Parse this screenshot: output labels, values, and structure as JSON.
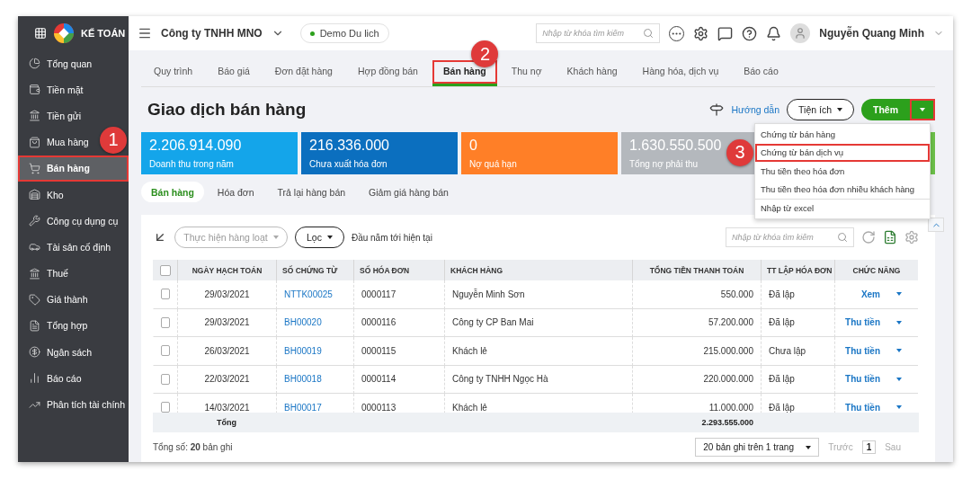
{
  "logo": {
    "text": "KẾ TOÁN"
  },
  "topbar": {
    "company": "Công ty TNHH MNO",
    "db_badge": "Demo Du lich",
    "search_placeholder": "Nhập từ khóa tìm kiếm",
    "user": "Nguyễn Quang Minh"
  },
  "sidebar": {
    "items": [
      {
        "label": "Tổng quan",
        "selected": false,
        "highlighted": false
      },
      {
        "label": "Tiền mặt",
        "selected": false,
        "highlighted": false
      },
      {
        "label": "Tiền gửi",
        "selected": false,
        "highlighted": false
      },
      {
        "label": "Mua hàng",
        "selected": false,
        "highlighted": false
      },
      {
        "label": "Bán hàng",
        "selected": true,
        "highlighted": true,
        "callout": "1"
      },
      {
        "label": "Kho",
        "selected": false,
        "highlighted": false
      },
      {
        "label": "Công cụ dụng cụ",
        "selected": false,
        "highlighted": false
      },
      {
        "label": "Tài sản cố định",
        "selected": false,
        "highlighted": false
      },
      {
        "label": "Thuế",
        "selected": false,
        "highlighted": false
      },
      {
        "label": "Giá thành",
        "selected": false,
        "highlighted": false
      },
      {
        "label": "Tổng hợp",
        "selected": false,
        "highlighted": false
      },
      {
        "label": "Ngân sách",
        "selected": false,
        "highlighted": false
      },
      {
        "label": "Báo cáo",
        "selected": false,
        "highlighted": false
      },
      {
        "label": "Phân tích tài chính",
        "selected": false,
        "highlighted": false
      }
    ]
  },
  "tabs": [
    {
      "label": "Quy trình",
      "selected": false,
      "highlighted": false
    },
    {
      "label": "Báo giá",
      "selected": false,
      "highlighted": false
    },
    {
      "label": "Đơn đặt hàng",
      "selected": false,
      "highlighted": false
    },
    {
      "label": "Hợp đồng bán",
      "selected": false,
      "highlighted": false
    },
    {
      "label": "Bán hàng",
      "selected": true,
      "highlighted": true,
      "callout": "2"
    },
    {
      "label": "Thu nợ",
      "selected": false,
      "highlighted": false
    },
    {
      "label": "Khách hàng",
      "selected": false,
      "highlighted": false
    },
    {
      "label": "Hàng hóa, dịch vụ",
      "selected": false,
      "highlighted": false
    },
    {
      "label": "Báo cáo",
      "selected": false,
      "highlighted": false
    }
  ],
  "page_title": "Giao dịch bán hàng",
  "actions": {
    "guide": "Hướng dẫn",
    "utilities": "Tiện ích",
    "add": "Thêm",
    "add_menu_highlighted": true
  },
  "add_menu": [
    {
      "label": "Chứng từ bán hàng",
      "highlighted": false
    },
    {
      "label": "Chứng từ bán dịch vụ",
      "highlighted": true,
      "callout": "3"
    },
    {
      "label": "Thu tiền theo hóa đơn",
      "highlighted": false
    },
    {
      "label": "Thu tiền theo hóa đơn nhiều khách hàng",
      "highlighted": false
    },
    {
      "label": "Nhập từ excel",
      "highlighted": false
    }
  ],
  "cards": [
    {
      "value": "2.206.914.090",
      "label": "Doanh thu trong năm",
      "color": "#14a5ea"
    },
    {
      "value": "216.336.000",
      "label": "Chưa xuất hóa đơn",
      "color": "#0b6fbf"
    },
    {
      "value": "0",
      "label": "Nợ quá hạn",
      "color": "#ff7f27"
    },
    {
      "value": "1.630.550.500",
      "label": "Tổng nợ phải thu",
      "color": "#b4b8bd"
    },
    {
      "color": "#6cc04a"
    }
  ],
  "sub_tabs": [
    {
      "label": "Bán hàng",
      "selected": true
    },
    {
      "label": "Hóa đơn",
      "selected": false
    },
    {
      "label": "Trả lại hàng bán",
      "selected": false
    },
    {
      "label": "Giảm giá hàng bán",
      "selected": false
    }
  ],
  "toolbar": {
    "bulk_action": {
      "label": "Thực hiện hàng loạt",
      "disabled": true
    },
    "filter": "Lọc",
    "period": "Đầu năm tới hiện tại",
    "search_placeholder": "Nhập từ khóa tìm kiếm"
  },
  "table": {
    "columns": [
      "NGÀY HẠCH TOÁN",
      "SỐ CHỨNG TỪ",
      "SỐ HÓA ĐƠN",
      "KHÁCH HÀNG",
      "TỔNG TIỀN THANH TOÁN",
      "TT LẬP HÓA ĐƠN",
      "CHỨC NĂNG"
    ],
    "header_checked": false,
    "rows": [
      {
        "checked": false,
        "date": "29/03/2021",
        "voucher": "NTTK00025",
        "invoice": "0000117",
        "customer": "Nguyễn Minh Sơn",
        "total": "550.000",
        "status": "Đã lập",
        "action": "Xem"
      },
      {
        "checked": false,
        "date": "29/03/2021",
        "voucher": "BH00020",
        "invoice": "0000116",
        "customer": "Công ty CP Ban Mai",
        "total": "57.200.000",
        "status": "Đã lập",
        "action": "Thu tiền"
      },
      {
        "checked": false,
        "date": "26/03/2021",
        "voucher": "BH00019",
        "invoice": "0000115",
        "customer": "Khách lẻ",
        "total": "215.000.000",
        "status": "Chưa lập",
        "action": "Thu tiền"
      },
      {
        "checked": false,
        "date": "22/03/2021",
        "voucher": "BH00018",
        "invoice": "0000114",
        "customer": "Công ty TNHH Ngọc Hà",
        "total": "220.000.000",
        "status": "Đã lập",
        "action": "Thu tiền"
      },
      {
        "checked": false,
        "date": "14/03/2021",
        "voucher": "BH00017",
        "invoice": "0000113",
        "customer": "Khách lẻ",
        "total": "11.000.000",
        "status": "Đã lập",
        "action": "Thu tiền"
      }
    ],
    "total_label": "Tổng",
    "total_value": "2.293.555.000"
  },
  "footer": {
    "record_count": "Tổng số: **20** bản ghi",
    "page_size": "20 bản ghi trên 1 trang",
    "prev": {
      "label": "Trước",
      "disabled": true
    },
    "page": "1",
    "next": {
      "label": "Sau",
      "disabled": true
    }
  }
}
